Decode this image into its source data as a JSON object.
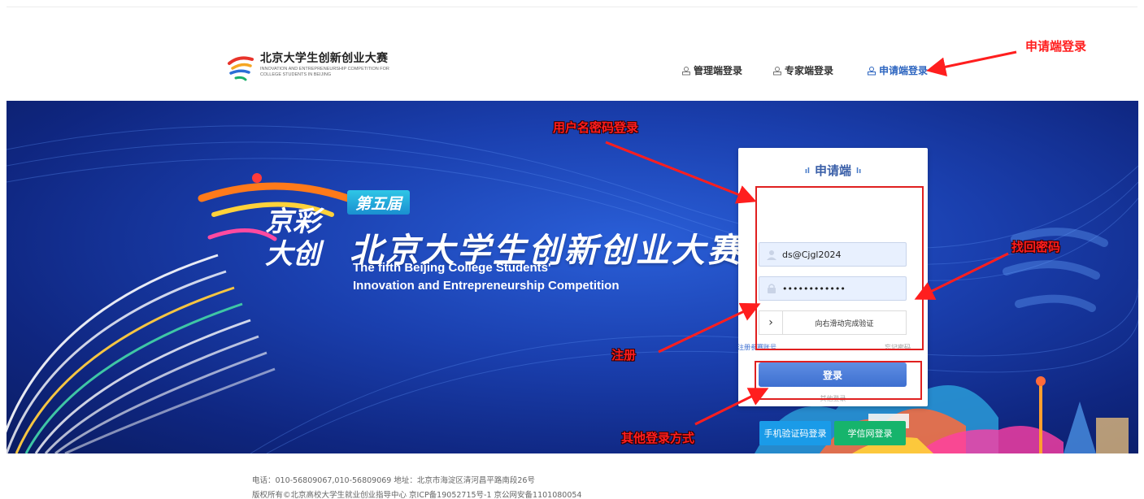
{
  "header": {
    "logo_title": "北京大学生创新创业大赛",
    "logo_subtitle": "INNOVATION AND ENTREPRENEURSHIP COMPETITION FOR COLLEGE STUDENTS IN BEIJING",
    "nav": [
      {
        "label": "管理端登录",
        "icon": "user-group-icon"
      },
      {
        "label": "专家端登录",
        "icon": "user-group-icon"
      },
      {
        "label": "申请端登录",
        "icon": "user-group-icon",
        "active": true
      }
    ]
  },
  "banner": {
    "badge": "第五届",
    "title": "北京大学生创新创业大赛",
    "subtitle_line1": "The fifth Beijing College Students'",
    "subtitle_line2": "Innovation and Entrepreneurship Competition",
    "logo_text": "京彩大创"
  },
  "login": {
    "title": "申请端",
    "username_value": "ds@Cjgl2024",
    "password_value": "••••••••••••",
    "slider_handle": "›",
    "slider_text": "向右滑动完成验证",
    "register_link": "注册参赛账号",
    "forgot_link": "忘记密码",
    "login_button": "登录",
    "other_label": "其他登录",
    "sms_login": "手机验证码登录",
    "xuexin_login": "学信网登录"
  },
  "annotations": {
    "applicant_login": "申请端登录",
    "password_login": "用户名密码登录",
    "find_password": "找回密码",
    "register": "注册",
    "other_methods": "其他登录方式"
  },
  "footer": {
    "contact": "电话：010-56809067,010-56809069   地址：北京市海淀区清河昌平路南段26号",
    "copyright": "版权所有©北京高校大学生就业创业指导中心 京ICP备19052715号-1 京公网安备1101080054"
  },
  "colors": {
    "primary_blue": "#3d6fd0",
    "sms_button": "#1a9be8",
    "xuexin_button": "#16b46c",
    "annotation_red": "#ff1e1e",
    "banner_blue": "#1a3fae"
  }
}
